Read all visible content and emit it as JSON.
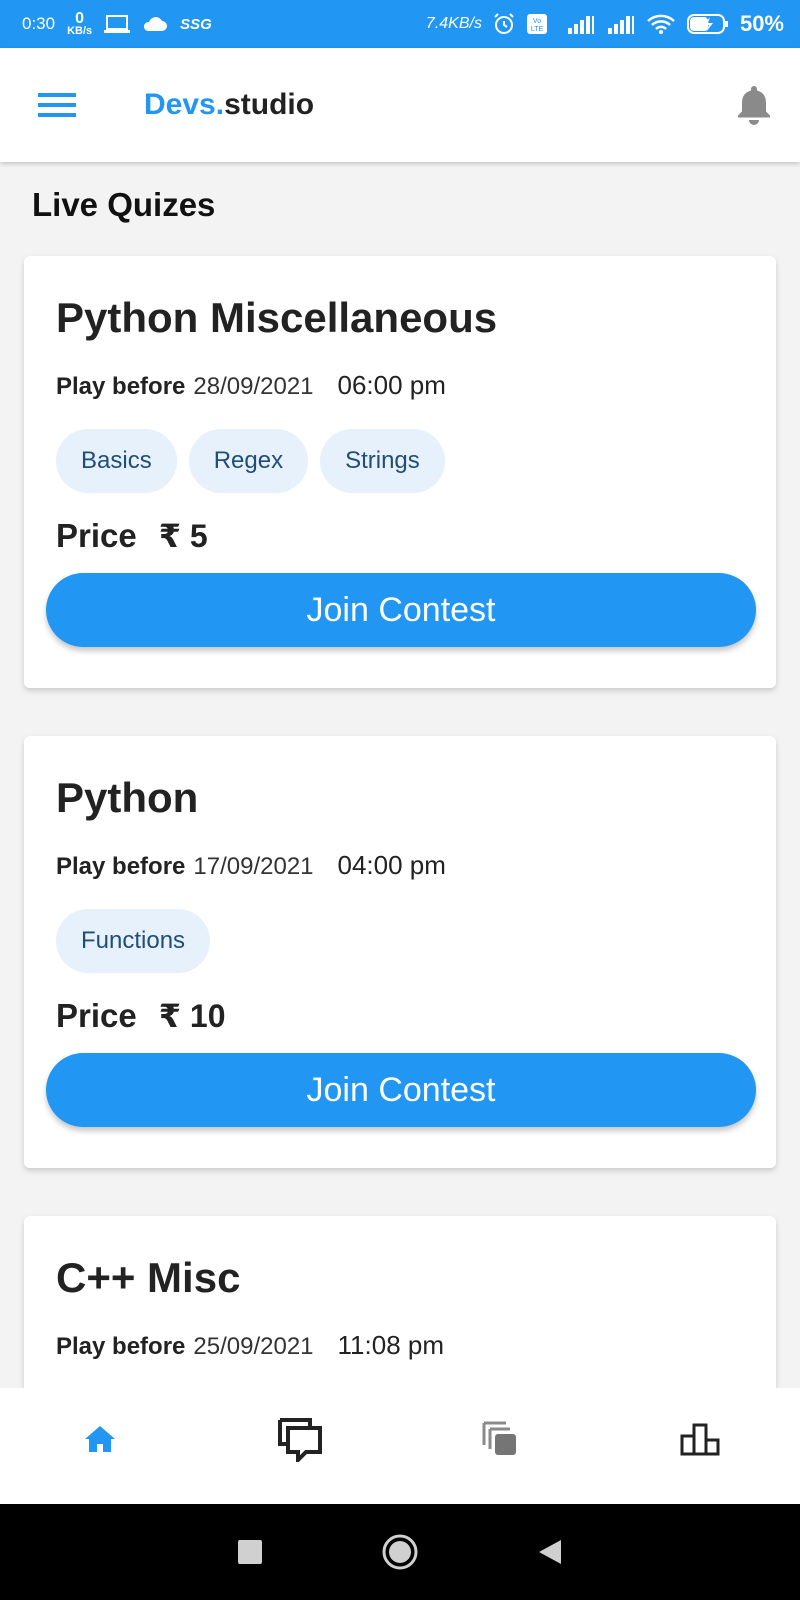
{
  "status_bar": {
    "time": "0:30",
    "net_speed_left_value": "0",
    "net_speed_left_unit": "KB/s",
    "carrier": "SSG",
    "net_speed_right": "7.4KB/s",
    "battery": "50%"
  },
  "app_bar": {
    "brand_accent": "Devs.",
    "brand_rest": "studio"
  },
  "section_title": "Live Quizes",
  "quizzes": [
    {
      "title": "Python Miscellaneous",
      "play_label": "Play before",
      "date": "28/09/2021",
      "time": "06:00 pm",
      "tags": [
        "Basics",
        "Regex",
        "Strings"
      ],
      "price_label": "Price",
      "price": "₹ 5",
      "button": "Join Contest"
    },
    {
      "title": "Python",
      "play_label": "Play before",
      "date": "17/09/2021",
      "time": "04:00 pm",
      "tags": [
        "Functions"
      ],
      "price_label": "Price",
      "price": "₹ 10",
      "button": "Join Contest"
    },
    {
      "title": "C++ Misc",
      "play_label": "Play before",
      "date": "25/09/2021",
      "time": "11:08 pm"
    }
  ],
  "bottom_nav": [
    "home-icon",
    "chat-icon",
    "copy-icon",
    "leaderboard-icon"
  ],
  "colors": {
    "accent": "#2196f3",
    "tag_bg": "#e6f1fc",
    "tag_text": "#1f4e79"
  }
}
